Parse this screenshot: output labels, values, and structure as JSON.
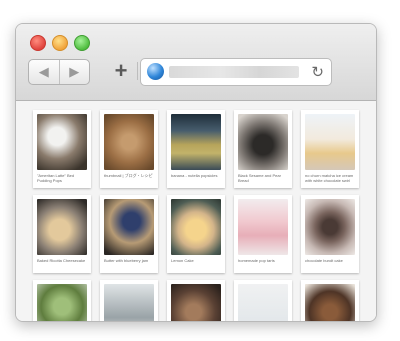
{
  "window": {
    "back_glyph": "◀",
    "forward_glyph": "▶",
    "new_tab_glyph": "+",
    "reload_glyph": "↻",
    "icons": [
      "close-icon",
      "minimize-icon",
      "zoom-icon",
      "back-icon",
      "forward-icon",
      "plus-icon",
      "globe-icon",
      "reload-icon"
    ]
  },
  "board": {
    "cards": [
      {
        "caption": "\"Ameritan Latte\" Bed Pudding Pops"
      },
      {
        "caption": "thumbnail | ブログ・レシピ"
      },
      {
        "caption": "banana - nutella popsicles"
      },
      {
        "caption": "Black Sesame and Pear Bread"
      },
      {
        "caption": "no churn matcha ice cream with white chocolate swirl"
      },
      {
        "caption": "Baked Ricotta Cheesecake"
      },
      {
        "caption": "Butter with blueberry jam"
      },
      {
        "caption": "Lemon Cake"
      },
      {
        "caption": "homemade pop tarts"
      },
      {
        "caption": "chocolate bundt cake"
      },
      {
        "caption": ""
      },
      {
        "caption": ""
      },
      {
        "caption": ""
      },
      {
        "caption": ""
      },
      {
        "caption": ""
      }
    ]
  },
  "colors": {
    "close": "#e0443e",
    "minimize": "#f1a33b",
    "zoom": "#4fbd3f",
    "globe": "#2f86d9"
  }
}
